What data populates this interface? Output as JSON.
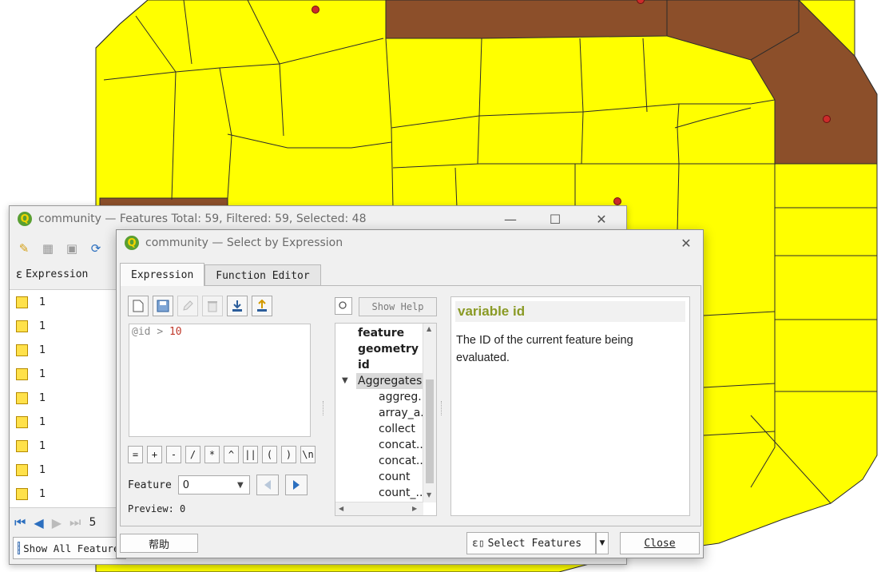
{
  "map": {
    "colors": {
      "yellow": "#ffff00",
      "brown": "#8c4f2a",
      "point": "#cc2b2b",
      "stroke": "#2b2b2b"
    }
  },
  "attr_window": {
    "title": "community — Features Total: 59, Filtered: 59, Selected: 48",
    "expression_label": "Expression",
    "rows": [
      "1",
      "1",
      "1",
      "1",
      "1",
      "1",
      "1",
      "1",
      "1"
    ],
    "page_partial": "5",
    "show_all": "Show All Features"
  },
  "dialog": {
    "title": "community — Select by Expression",
    "tabs": [
      {
        "label": "Expression"
      },
      {
        "label": "Function Editor"
      }
    ],
    "expression": {
      "var": "@id",
      "op": ">",
      "num": "10"
    },
    "operators": [
      "=",
      "+",
      "-",
      "/",
      "*",
      "^",
      "||",
      "(",
      ")",
      "\\n"
    ],
    "feature_label": "Feature",
    "feature_value": "0",
    "preview_label": "Preview:",
    "preview_value": "0",
    "show_help": "Show Help",
    "tree": {
      "top": [
        "feature",
        "geometry",
        "id"
      ],
      "group": "Aggregates",
      "children": [
        "aggreg...",
        "array_a...",
        "collect",
        "concat...",
        "concat...",
        "count",
        "count_..."
      ]
    },
    "help": {
      "title": "variable id",
      "text": "The ID of the current feature being evaluated."
    },
    "buttons": {
      "help": "帮助",
      "select": "Select Features",
      "close": "Close"
    }
  }
}
